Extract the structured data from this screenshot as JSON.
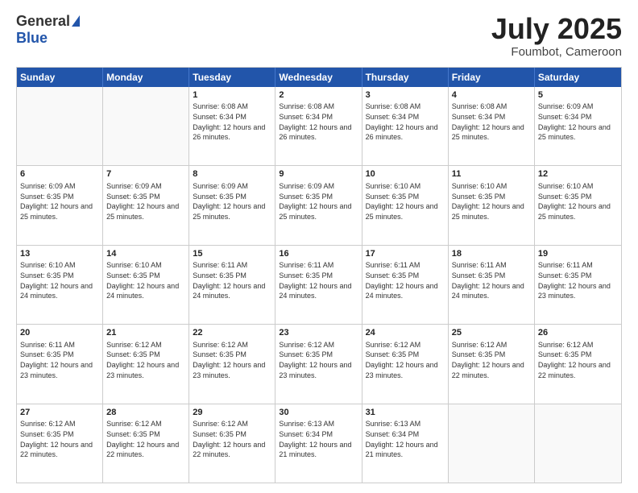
{
  "header": {
    "logo_general": "General",
    "logo_blue": "Blue",
    "title": "July 2025",
    "location": "Foumbot, Cameroon"
  },
  "days_of_week": [
    "Sunday",
    "Monday",
    "Tuesday",
    "Wednesday",
    "Thursday",
    "Friday",
    "Saturday"
  ],
  "weeks": [
    [
      {
        "day": "",
        "sunrise": "",
        "sunset": "",
        "daylight": ""
      },
      {
        "day": "",
        "sunrise": "",
        "sunset": "",
        "daylight": ""
      },
      {
        "day": "1",
        "sunrise": "Sunrise: 6:08 AM",
        "sunset": "Sunset: 6:34 PM",
        "daylight": "Daylight: 12 hours and 26 minutes."
      },
      {
        "day": "2",
        "sunrise": "Sunrise: 6:08 AM",
        "sunset": "Sunset: 6:34 PM",
        "daylight": "Daylight: 12 hours and 26 minutes."
      },
      {
        "day": "3",
        "sunrise": "Sunrise: 6:08 AM",
        "sunset": "Sunset: 6:34 PM",
        "daylight": "Daylight: 12 hours and 26 minutes."
      },
      {
        "day": "4",
        "sunrise": "Sunrise: 6:08 AM",
        "sunset": "Sunset: 6:34 PM",
        "daylight": "Daylight: 12 hours and 25 minutes."
      },
      {
        "day": "5",
        "sunrise": "Sunrise: 6:09 AM",
        "sunset": "Sunset: 6:34 PM",
        "daylight": "Daylight: 12 hours and 25 minutes."
      }
    ],
    [
      {
        "day": "6",
        "sunrise": "Sunrise: 6:09 AM",
        "sunset": "Sunset: 6:35 PM",
        "daylight": "Daylight: 12 hours and 25 minutes."
      },
      {
        "day": "7",
        "sunrise": "Sunrise: 6:09 AM",
        "sunset": "Sunset: 6:35 PM",
        "daylight": "Daylight: 12 hours and 25 minutes."
      },
      {
        "day": "8",
        "sunrise": "Sunrise: 6:09 AM",
        "sunset": "Sunset: 6:35 PM",
        "daylight": "Daylight: 12 hours and 25 minutes."
      },
      {
        "day": "9",
        "sunrise": "Sunrise: 6:09 AM",
        "sunset": "Sunset: 6:35 PM",
        "daylight": "Daylight: 12 hours and 25 minutes."
      },
      {
        "day": "10",
        "sunrise": "Sunrise: 6:10 AM",
        "sunset": "Sunset: 6:35 PM",
        "daylight": "Daylight: 12 hours and 25 minutes."
      },
      {
        "day": "11",
        "sunrise": "Sunrise: 6:10 AM",
        "sunset": "Sunset: 6:35 PM",
        "daylight": "Daylight: 12 hours and 25 minutes."
      },
      {
        "day": "12",
        "sunrise": "Sunrise: 6:10 AM",
        "sunset": "Sunset: 6:35 PM",
        "daylight": "Daylight: 12 hours and 25 minutes."
      }
    ],
    [
      {
        "day": "13",
        "sunrise": "Sunrise: 6:10 AM",
        "sunset": "Sunset: 6:35 PM",
        "daylight": "Daylight: 12 hours and 24 minutes."
      },
      {
        "day": "14",
        "sunrise": "Sunrise: 6:10 AM",
        "sunset": "Sunset: 6:35 PM",
        "daylight": "Daylight: 12 hours and 24 minutes."
      },
      {
        "day": "15",
        "sunrise": "Sunrise: 6:11 AM",
        "sunset": "Sunset: 6:35 PM",
        "daylight": "Daylight: 12 hours and 24 minutes."
      },
      {
        "day": "16",
        "sunrise": "Sunrise: 6:11 AM",
        "sunset": "Sunset: 6:35 PM",
        "daylight": "Daylight: 12 hours and 24 minutes."
      },
      {
        "day": "17",
        "sunrise": "Sunrise: 6:11 AM",
        "sunset": "Sunset: 6:35 PM",
        "daylight": "Daylight: 12 hours and 24 minutes."
      },
      {
        "day": "18",
        "sunrise": "Sunrise: 6:11 AM",
        "sunset": "Sunset: 6:35 PM",
        "daylight": "Daylight: 12 hours and 24 minutes."
      },
      {
        "day": "19",
        "sunrise": "Sunrise: 6:11 AM",
        "sunset": "Sunset: 6:35 PM",
        "daylight": "Daylight: 12 hours and 23 minutes."
      }
    ],
    [
      {
        "day": "20",
        "sunrise": "Sunrise: 6:11 AM",
        "sunset": "Sunset: 6:35 PM",
        "daylight": "Daylight: 12 hours and 23 minutes."
      },
      {
        "day": "21",
        "sunrise": "Sunrise: 6:12 AM",
        "sunset": "Sunset: 6:35 PM",
        "daylight": "Daylight: 12 hours and 23 minutes."
      },
      {
        "day": "22",
        "sunrise": "Sunrise: 6:12 AM",
        "sunset": "Sunset: 6:35 PM",
        "daylight": "Daylight: 12 hours and 23 minutes."
      },
      {
        "day": "23",
        "sunrise": "Sunrise: 6:12 AM",
        "sunset": "Sunset: 6:35 PM",
        "daylight": "Daylight: 12 hours and 23 minutes."
      },
      {
        "day": "24",
        "sunrise": "Sunrise: 6:12 AM",
        "sunset": "Sunset: 6:35 PM",
        "daylight": "Daylight: 12 hours and 23 minutes."
      },
      {
        "day": "25",
        "sunrise": "Sunrise: 6:12 AM",
        "sunset": "Sunset: 6:35 PM",
        "daylight": "Daylight: 12 hours and 22 minutes."
      },
      {
        "day": "26",
        "sunrise": "Sunrise: 6:12 AM",
        "sunset": "Sunset: 6:35 PM",
        "daylight": "Daylight: 12 hours and 22 minutes."
      }
    ],
    [
      {
        "day": "27",
        "sunrise": "Sunrise: 6:12 AM",
        "sunset": "Sunset: 6:35 PM",
        "daylight": "Daylight: 12 hours and 22 minutes."
      },
      {
        "day": "28",
        "sunrise": "Sunrise: 6:12 AM",
        "sunset": "Sunset: 6:35 PM",
        "daylight": "Daylight: 12 hours and 22 minutes."
      },
      {
        "day": "29",
        "sunrise": "Sunrise: 6:12 AM",
        "sunset": "Sunset: 6:35 PM",
        "daylight": "Daylight: 12 hours and 22 minutes."
      },
      {
        "day": "30",
        "sunrise": "Sunrise: 6:13 AM",
        "sunset": "Sunset: 6:34 PM",
        "daylight": "Daylight: 12 hours and 21 minutes."
      },
      {
        "day": "31",
        "sunrise": "Sunrise: 6:13 AM",
        "sunset": "Sunset: 6:34 PM",
        "daylight": "Daylight: 12 hours and 21 minutes."
      },
      {
        "day": "",
        "sunrise": "",
        "sunset": "",
        "daylight": ""
      },
      {
        "day": "",
        "sunrise": "",
        "sunset": "",
        "daylight": ""
      }
    ]
  ]
}
